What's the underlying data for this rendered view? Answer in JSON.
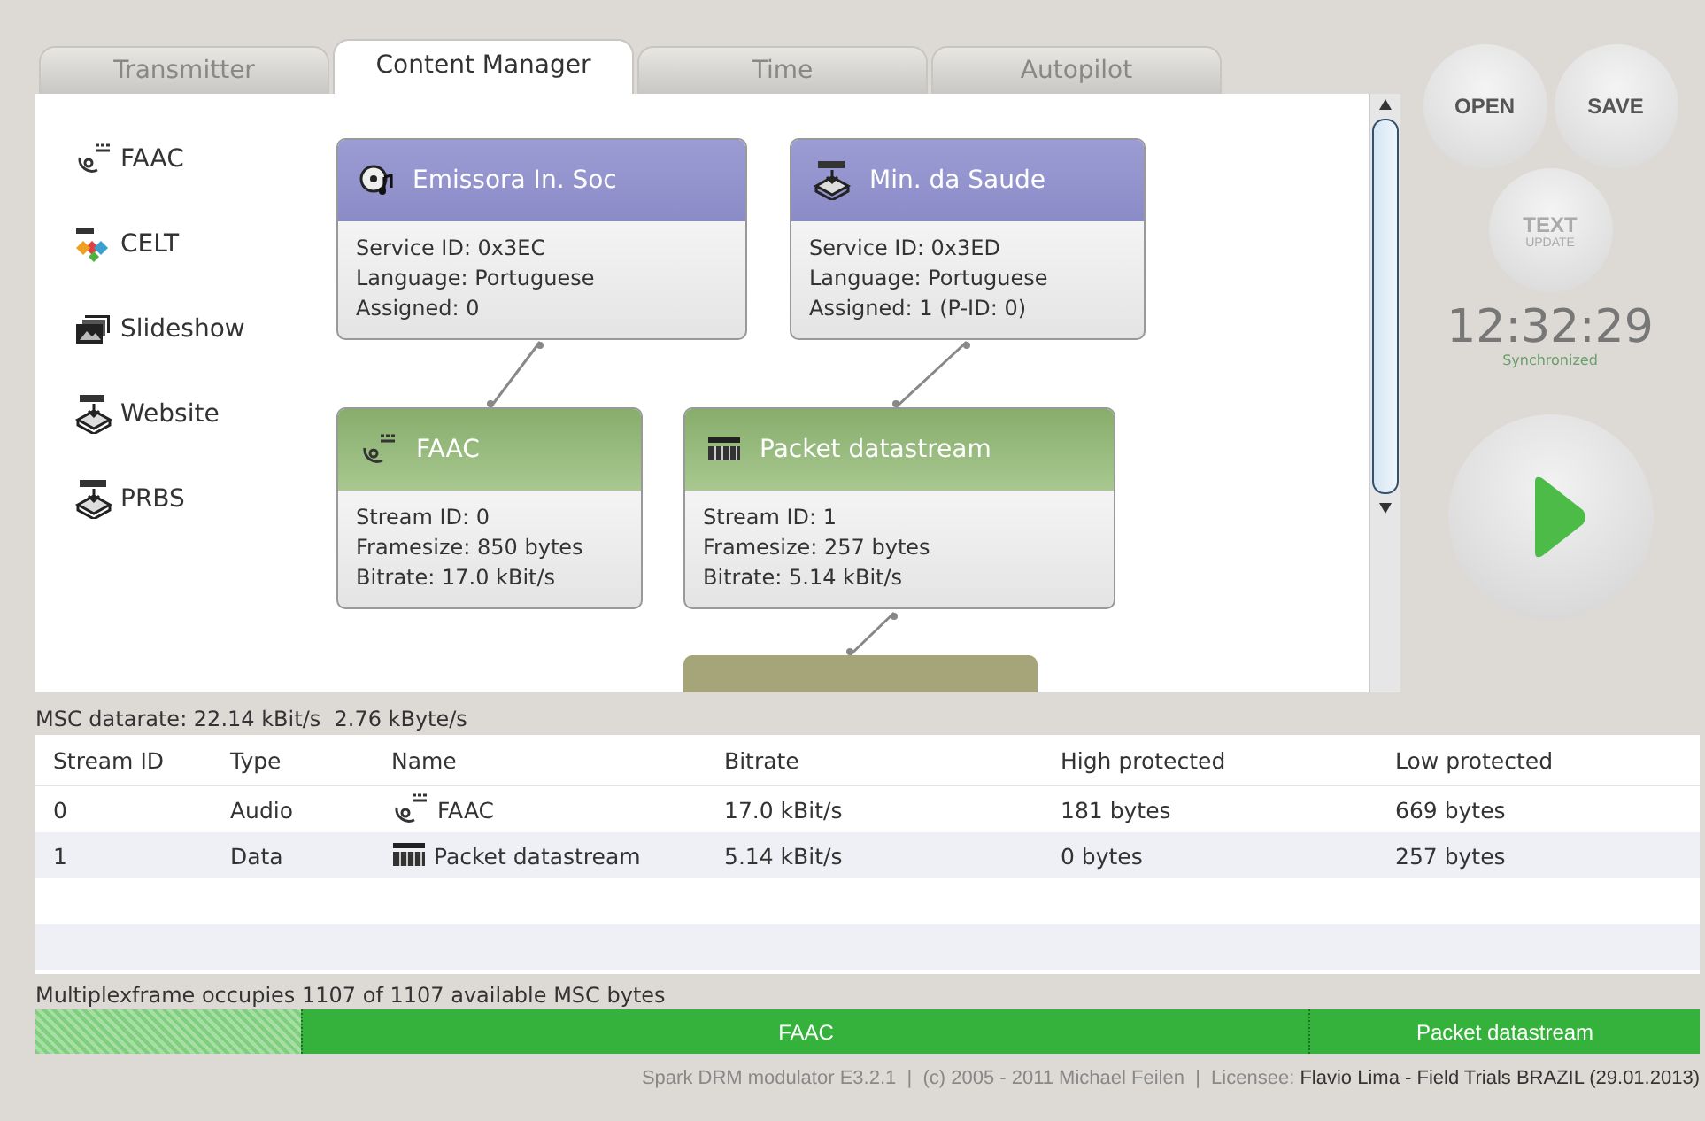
{
  "tabs": [
    {
      "label": "Transmitter",
      "selected": false
    },
    {
      "label": "Content Manager",
      "selected": true
    },
    {
      "label": "Time",
      "selected": false
    },
    {
      "label": "Autopilot",
      "selected": false
    }
  ],
  "sources": [
    {
      "kind": "aac",
      "label": "FAAC"
    },
    {
      "kind": "celt",
      "label": "CELT"
    },
    {
      "kind": "slides",
      "label": "Slideshow"
    },
    {
      "kind": "html",
      "label": "Website"
    },
    {
      "kind": "prbs",
      "label": "PRBS"
    }
  ],
  "nodes": [
    {
      "kind": "service",
      "title": "Emissora In. Soc",
      "lines": [
        "Service ID: 0x3EC",
        "Language: Portuguese",
        "Assigned: 0"
      ]
    },
    {
      "kind": "service",
      "title": "Min. da Saude",
      "lines": [
        "Service ID: 0x3ED",
        "Language: Portuguese",
        "Assigned: 1 (P-ID: 0)"
      ]
    },
    {
      "kind": "stream",
      "title": "FAAC",
      "lines": [
        "Stream ID: 0",
        "Framesize: 850 bytes",
        "Bitrate: 17.0 kBit/s"
      ]
    },
    {
      "kind": "stream",
      "title": "Packet datastream",
      "lines": [
        "Stream ID: 1",
        "Framesize: 257 bytes",
        "Bitrate: 5.14 kBit/s"
      ]
    },
    {
      "kind": "encoder"
    }
  ],
  "buttons": [
    {
      "kind": "plain",
      "label": "OPEN",
      "disabled": false
    },
    {
      "kind": "plain",
      "label": "SAVE",
      "disabled": false
    },
    {
      "kind": "stacked",
      "label": "TEXT",
      "sublabel": "UPDATE",
      "disabled": true
    }
  ],
  "clock": {
    "time": "12:32:29",
    "status": "Synchronized"
  },
  "datarate": "MSC datarate: 22.14 kBit/s  2.76 kByte/s",
  "table": {
    "columns": [
      "Stream ID",
      "Type",
      "Name",
      "Bitrate",
      "High protected",
      "Low protected"
    ],
    "rows": [
      {
        "cells": [
          "0",
          "Audio",
          "FAAC",
          "17.0 kBit/s",
          "181 bytes",
          "669 bytes"
        ]
      },
      {
        "cells": [
          "1",
          "Data",
          "Packet datastream",
          "5.14 kBit/s",
          "0 bytes",
          "257 bytes"
        ]
      }
    ]
  },
  "multiplex": {
    "caption": "Multiplexframe occupies 1107 of 1107 available MSC bytes",
    "segments": [
      {
        "kind": "padding"
      },
      {
        "kind": "stream",
        "label": "FAAC"
      },
      {
        "kind": "stream",
        "label": "Packet datastream"
      }
    ]
  },
  "footer": {
    "text": "Spark DRM modulator E3.2.1  |  (c) 2005 - 2011 Michael Feilen  |  Licensee: ",
    "licensee": "Flavio Lima - Field Trials BRAZIL (29.01.2013)"
  }
}
